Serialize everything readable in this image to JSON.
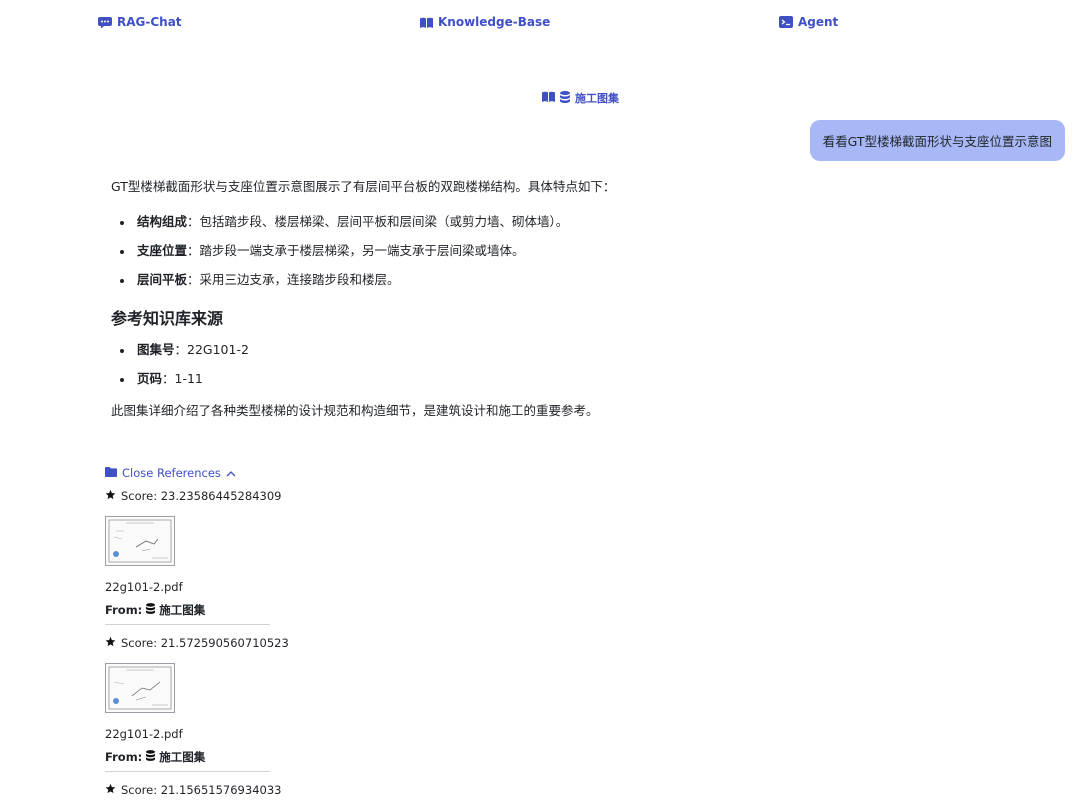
{
  "nav": {
    "chat_label": "RAG-Chat",
    "kb_label": "Knowledge-Base",
    "agent_label": "Agent",
    "accent_color": "#3f4fc4"
  },
  "kb_indicator": {
    "label": "施工图集"
  },
  "user_message": "看看GT型楼梯截面形状与支座位置示意图",
  "answer": {
    "intro": "GT型楼梯截面形状与支座位置示意图展示了有层间平台板的双跑楼梯结构。具体特点如下：",
    "bullets": [
      {
        "term": "结构组成",
        "text": "：包括踏步段、楼层梯梁、层间平板和层间梁（或剪力墙、砌体墙）。"
      },
      {
        "term": "支座位置",
        "text": "：踏步段一端支承于楼层梯梁，另一端支承于层间梁或墙体。"
      },
      {
        "term": "层间平板",
        "text": "：采用三边支承，连接踏步段和楼层。"
      }
    ],
    "ref_heading": "参考知识库来源",
    "ref_bullets": [
      {
        "term": "图集号",
        "text": "：22G101-2"
      },
      {
        "term": "页码",
        "text": "：1-11"
      }
    ],
    "closing": "此图集详细介绍了各种类型楼梯的设计规范和构造细节，是建筑设计和施工的重要参考。"
  },
  "references": {
    "toggle_label": "Close References",
    "items": [
      {
        "score": "Score: 23.23586445284309",
        "file": "22g101-2.pdf",
        "from_label": "From:",
        "source": "施工图集"
      },
      {
        "score": "Score: 21.572590560710523",
        "file": "22g101-2.pdf",
        "from_label": "From:",
        "source": "施工图集"
      },
      {
        "score": "Score: 21.15651576934033"
      }
    ]
  },
  "icons": {
    "chat": "chat-bubble-icon",
    "book": "book-open-icon",
    "terminal": "terminal-icon",
    "database": "database-icon",
    "folder": "folder-icon",
    "star": "star-icon",
    "chevron": "chevron-up-icon"
  }
}
